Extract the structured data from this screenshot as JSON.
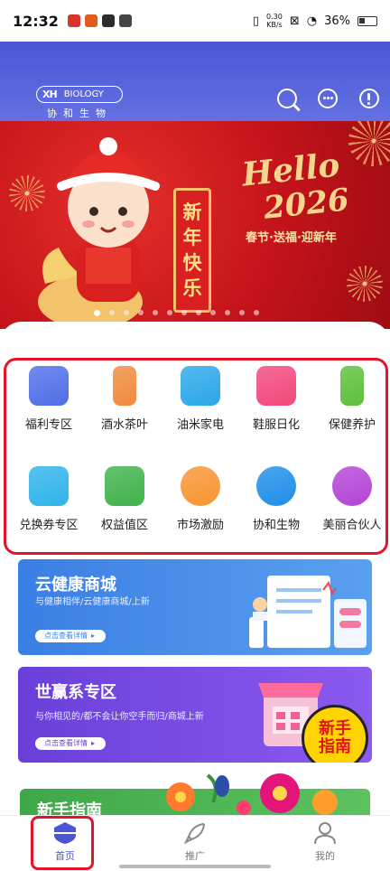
{
  "status_bar": {
    "time": "12:32",
    "net_speed_value": "0.30",
    "net_speed_unit": "KB/s",
    "battery": "36%"
  },
  "header": {
    "logo_mark": "XH",
    "logo_en": "BIOLOGY",
    "logo_cn": "协和生物",
    "icons": [
      "search-icon",
      "chat-icon",
      "info-icon"
    ]
  },
  "banner": {
    "scroll_text": [
      "新",
      "年",
      "快",
      "乐"
    ],
    "hello": "Hello",
    "year": "2026",
    "subline": "春节·送福·迎新年",
    "dot_count": 12,
    "active_dot": 0
  },
  "categories": [
    {
      "label": "福利专区",
      "color": "#4f6ee8"
    },
    {
      "label": "酒水茶叶",
      "color": "#f08a3c"
    },
    {
      "label": "油米家电",
      "color": "#2aa7e8"
    },
    {
      "label": "鞋服日化",
      "color": "#f2477b"
    },
    {
      "label": "保健养护",
      "color": "#5cbf3a"
    },
    {
      "label": "兑换券专区",
      "color": "#2fb3ea"
    },
    {
      "label": "权益值区",
      "color": "#3fb24a"
    },
    {
      "label": "市场激励",
      "color": "#f79431"
    },
    {
      "label": "协和生物",
      "color": "#1e8ee8"
    },
    {
      "label": "美丽合伙人",
      "color": "#b443d6"
    }
  ],
  "promos": [
    {
      "title": "云健康商城",
      "subtitle": "与健康相伴/云健康商城/上新",
      "button": "点击查看详情",
      "color": "#3b82e6"
    },
    {
      "title": "世赢系专区",
      "subtitle": "与你相见的/都不会让你空手而归/商城上新",
      "button": "点击查看详情",
      "color": "#6c3fd8",
      "badge": [
        "新手",
        "指南"
      ]
    },
    {
      "title": "新手指南",
      "color": "#47b54a"
    }
  ],
  "tabs": [
    {
      "label": "首页",
      "active": true
    },
    {
      "label": "推广",
      "active": false
    },
    {
      "label": "我的",
      "active": false
    }
  ],
  "colors": {
    "header": "#4a56d4",
    "banner_red": "#c4131a",
    "highlight": "#e4152a",
    "active_tab": "#4a56d4"
  }
}
